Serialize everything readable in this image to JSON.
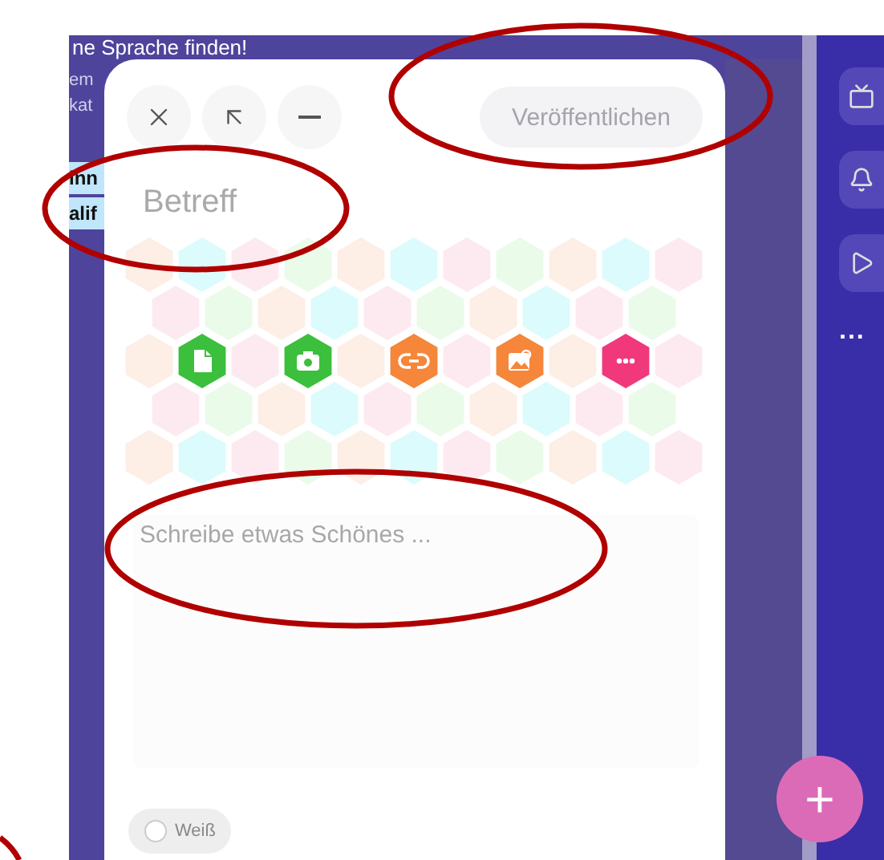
{
  "background": {
    "heading": "ne Sprache finden!",
    "fragments": [
      {
        "text": "em",
        "kind": "plain"
      },
      {
        "text": "kat",
        "kind": "plain"
      },
      {
        "text": "inn",
        "kind": "card"
      },
      {
        "text": "alif",
        "kind": "card"
      }
    ]
  },
  "composer": {
    "toolbar": [
      {
        "kind": "close"
      },
      {
        "kind": "expand"
      },
      {
        "kind": "minimize"
      }
    ],
    "publish": {
      "label": "Veröffentlichen",
      "disabled": true
    },
    "subject": {
      "placeholder": "Betreff"
    },
    "actions": [
      {
        "kind": "document",
        "color": "#3cbf3c"
      },
      {
        "kind": "camera",
        "color": "#3cbf3c"
      },
      {
        "kind": "link",
        "color": "#f5863a"
      },
      {
        "kind": "image",
        "color": "#f5863a"
      },
      {
        "kind": "more",
        "color": "#f0387a"
      }
    ],
    "body": {
      "placeholder": "Schreibe etwas Schönes ..."
    },
    "color_option": {
      "label": "Weiß",
      "selected": false
    }
  },
  "sidebar": {
    "items": [
      {
        "kind": "screen"
      },
      {
        "kind": "bell"
      },
      {
        "kind": "play"
      }
    ],
    "more": "..."
  },
  "fab": {
    "label": "+"
  }
}
